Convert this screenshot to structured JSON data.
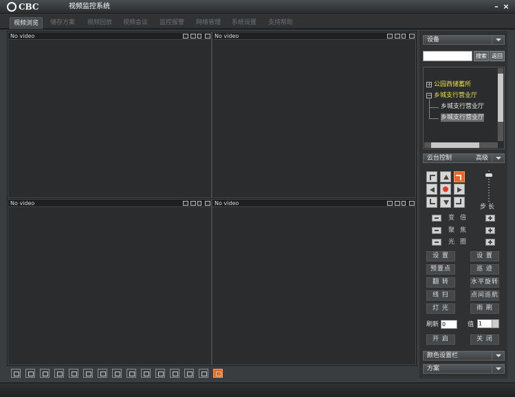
{
  "window": {
    "logo": "CBC",
    "title": "视频监控系统",
    "minimize": "–",
    "close": "×"
  },
  "tabs": [
    "视频浏览",
    "储存方案",
    "视频回放",
    "视频会议",
    "监控报警",
    "网络管理",
    "系统设置",
    "支持帮助"
  ],
  "active_tab": 0,
  "panes": [
    {
      "label": "No video"
    },
    {
      "label": "No video"
    },
    {
      "label": "No video"
    },
    {
      "label": "No video"
    }
  ],
  "right": {
    "device_label": "设备",
    "search_placeholder": "",
    "search_button": "搜索",
    "back_button": "返回",
    "tree": [
      {
        "label": "公园西储蓄所",
        "expander": "+",
        "color": "#e8e050"
      },
      {
        "label": "乡城支行营业厅",
        "expander": "−",
        "color": "#e8e050"
      },
      {
        "label": "乡城支行营业厅",
        "color": "#e6e6e6"
      },
      {
        "label": "乡城支行营业厅",
        "color": "#e6e6e6",
        "selected": true
      }
    ],
    "ptz_label": "云台控制",
    "ptz_advanced": "高级",
    "step_label": "步 长",
    "rows": [
      {
        "label": "变倍"
      },
      {
        "label": "聚焦"
      },
      {
        "label": "光圈"
      }
    ],
    "buttons": [
      [
        "设  置",
        "设  置"
      ],
      [
        "预置点",
        "巡  迹"
      ],
      [
        "翻  转",
        "水平旋转"
      ],
      [
        "线  扫",
        "点间巡航"
      ],
      [
        "灯  光",
        "雨  刷"
      ]
    ],
    "refresh_label": "刷新",
    "refresh_value": "0",
    "value_label": "值",
    "value_select": "1",
    "open_button": "开  启",
    "close_button": "关  闭",
    "color_label": "颜色设置栏",
    "scheme_label": "方案"
  },
  "colors": {
    "accent": "#e8652a",
    "tree_parent": "#e8e050",
    "background": "#3a3d40"
  }
}
